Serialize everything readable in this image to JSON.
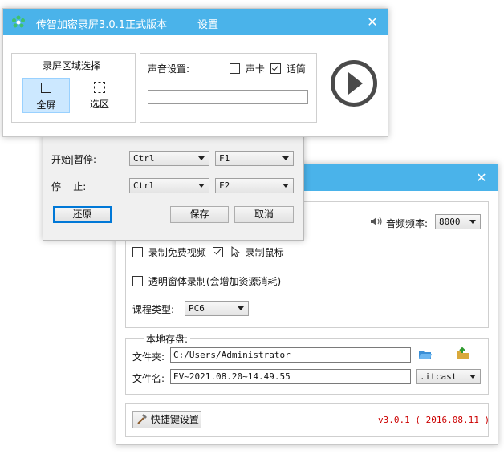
{
  "main_window": {
    "title": "传智加密录屏3.0.1正式版本",
    "settings_link": "设置",
    "minimize": "—",
    "close": "✕"
  },
  "record_area": {
    "title": "录屏区域选择",
    "fullscreen_label": "全屏",
    "selection_label": "选区"
  },
  "sound": {
    "label": "声音设置:",
    "soundcard_label": "声卡",
    "soundcard_checked": false,
    "mic_label": "话筒",
    "mic_checked": true,
    "level": 0
  },
  "play_button_icon": "play-circle-icon",
  "hotkeys": {
    "start_pause_label": "开始|暂停:",
    "start_modifier": "Ctrl",
    "start_key": "F1",
    "stop_label": "停    止:",
    "stop_modifier": "Ctrl",
    "stop_key": "F2",
    "restore_label": "还原",
    "save_label": "保存",
    "cancel_label": "取消"
  },
  "settings_window": {
    "close": "✕",
    "audio_rate_label": "音频频率:",
    "audio_rate_value": "8000",
    "record_free_video_label": "录制免费视频",
    "record_free_video_checked": false,
    "record_mouse_label": "录制鼠标",
    "record_mouse_checked": true,
    "transparent_label": "透明窗体录制(会增加资源消耗)",
    "transparent_checked": false,
    "course_type_label": "课程类型:",
    "course_type_value": "PC6",
    "storage_title": "本地存盘:",
    "folder_label": "文件夹:",
    "folder_value": "C:/Users/Administrator",
    "filename_label": "文件名:",
    "filename_value": "EV~2021.08.20~14.49.55",
    "extension_value": ".itcast",
    "shortcut_button_label": "快捷键设置",
    "version_text": "v3.0.1 ( 2016.08.11 )",
    "version_color": "#cc0000"
  },
  "colors": {
    "titlebar": "#4ab3ea",
    "selected_option": "#cce8ff"
  }
}
